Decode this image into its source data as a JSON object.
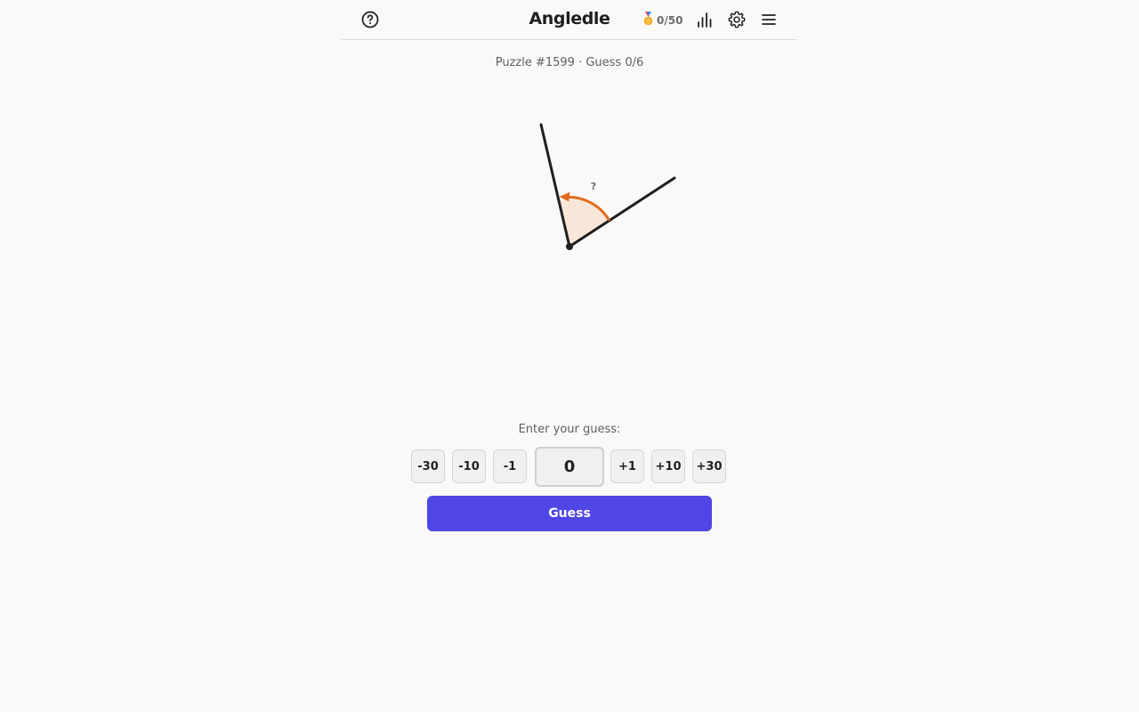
{
  "header": {
    "title": "Angledle",
    "score": "0/50",
    "icons": {
      "help": "help-circle-icon",
      "medal": "medal-icon",
      "stats": "bar-chart-icon",
      "settings": "gear-icon",
      "menu": "hamburger-menu-icon"
    }
  },
  "status": {
    "text": "Puzzle #1599 · Guess 0/6"
  },
  "diagram": {
    "unknown_label": "?",
    "colors": {
      "arm": "#1f1f1f",
      "arc": "#e36a1b",
      "fill": "#f8e6d8"
    }
  },
  "guess": {
    "label": "Enter your guess:",
    "value": "0",
    "decrements": [
      "-30",
      "-10",
      "-1"
    ],
    "increments": [
      "+1",
      "+10",
      "+30"
    ],
    "submit_label": "Guess"
  },
  "colors": {
    "accent": "#4f46e5",
    "background": "#faf9f7"
  }
}
